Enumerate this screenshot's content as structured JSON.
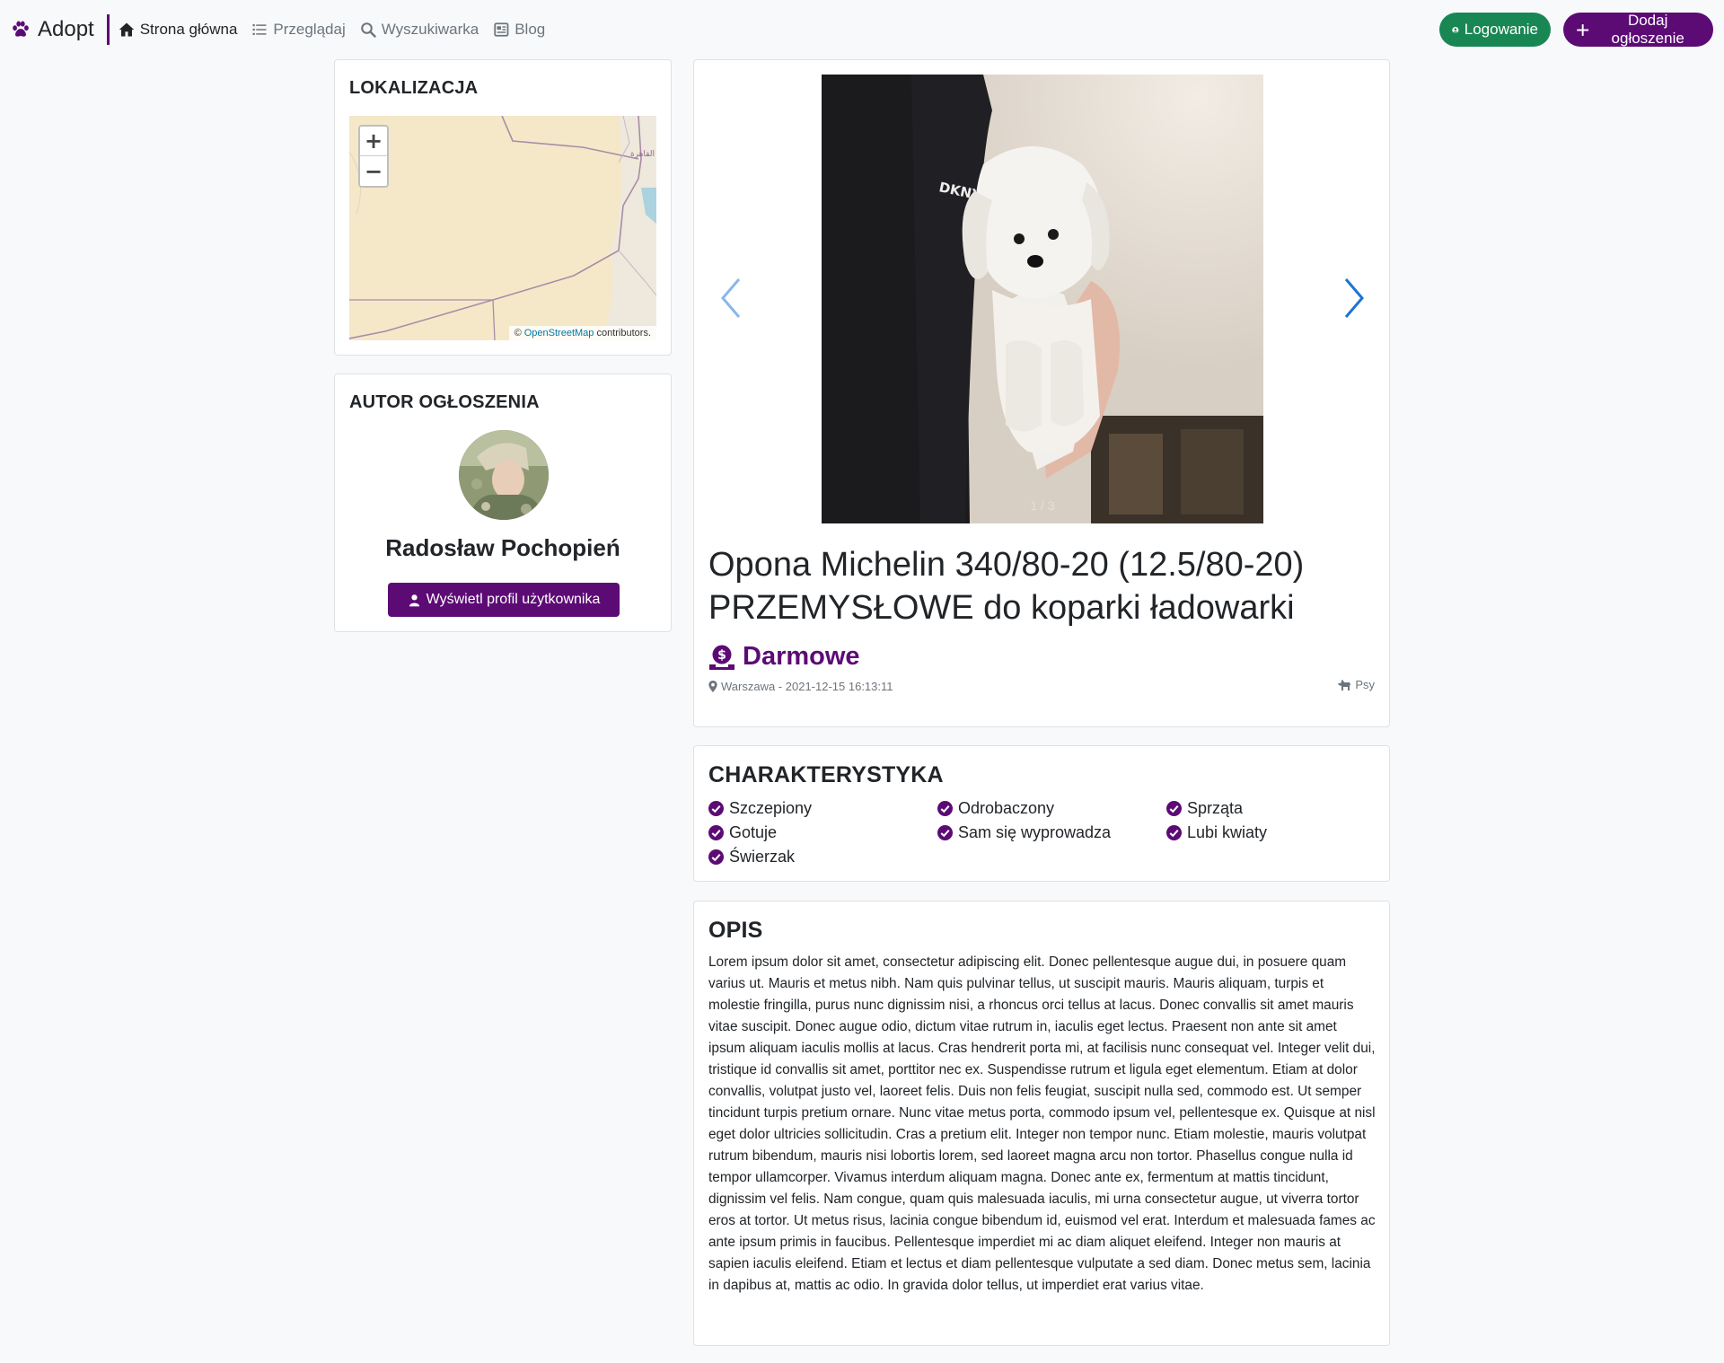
{
  "brand": {
    "name": "Adopt",
    "accent": "#5c0b75"
  },
  "nav": {
    "items": [
      {
        "label": "Strona główna",
        "icon": "home-icon",
        "active": true
      },
      {
        "label": "Przeglądaj",
        "icon": "list-icon",
        "active": false
      },
      {
        "label": "Wyszukiwarka",
        "icon": "search-icon",
        "active": false
      },
      {
        "label": "Blog",
        "icon": "newspaper-icon",
        "active": false
      }
    ],
    "login_label": "Logowanie",
    "add_label": "Dodaj ogłoszenie",
    "login_color": "#198754",
    "add_color": "#5c0b75"
  },
  "location": {
    "title": "LOKALIZACJA",
    "zoom_in": "+",
    "zoom_out": "−",
    "map_label": "القاهرة",
    "attribution_prefix": "©",
    "attribution_link": "OpenStreetMap",
    "attribution_suffix": "contributors."
  },
  "author": {
    "title": "AUTOR OGŁOSZENIA",
    "name": "Radosław Pochopień",
    "profile_button": "Wyświetl profil użytkownika"
  },
  "listing": {
    "gallery_counter": "1 / 3",
    "title": "Opona Michelin 340/80-20 (12.5/80-20) PRZEMYSŁOWE do koparki ładowarki",
    "price": "Darmowe",
    "location_date": "Warszawa - 2021-12-15 16:13:11",
    "category": "Psy"
  },
  "characteristics": {
    "title": "CHARAKTERYSTYKA",
    "items": [
      "Szczepiony",
      "Odrobaczony",
      "Sprząta",
      "Gotuje",
      "Sam się wyprowadza",
      "Lubi kwiaty",
      "Świerzak"
    ]
  },
  "description": {
    "title": "OPIS",
    "text": "Lorem ipsum dolor sit amet, consectetur adipiscing elit. Donec pellentesque augue dui, in posuere quam varius ut. Mauris et metus nibh. Nam quis pulvinar tellus, ut suscipit mauris. Mauris aliquam, turpis et molestie fringilla, purus nunc dignissim nisi, a rhoncus orci tellus at lacus. Donec convallis sit amet mauris vitae suscipit. Donec augue odio, dictum vitae rutrum in, iaculis eget lectus. Praesent non ante sit amet ipsum aliquam iaculis mollis at lacus. Cras hendrerit porta mi, at facilisis nunc consequat vel. Integer velit dui, tristique id convallis sit amet, porttitor nec ex. Suspendisse rutrum et ligula eget elementum. Etiam at dolor convallis, volutpat justo vel, laoreet felis. Duis non felis feugiat, suscipit nulla sed, commodo est. Ut semper tincidunt turpis pretium ornare. Nunc vitae metus porta, commodo ipsum vel, pellentesque ex. Quisque at nisl eget dolor ultricies sollicitudin. Cras a pretium elit. Integer non tempor nunc. Etiam molestie, mauris volutpat rutrum bibendum, mauris nisi lobortis lorem, sed laoreet magna arcu non tortor. Phasellus congue nulla id tempor ullamcorper. Vivamus interdum aliquam magna. Donec ante ex, fermentum at mattis tincidunt, dignissim vel felis. Nam congue, quam quis malesuada iaculis, mi urna consectetur augue, ut viverra tortor eros at tortor. Ut metus risus, lacinia congue bibendum id, euismod vel erat. Interdum et malesuada fames ac ante ipsum primis in faucibus. Pellentesque imperdiet mi ac diam aliquet eleifend. Integer non mauris at sapien iaculis eleifend. Etiam et lectus et diam pellentesque vulputate a sed diam. Donec metus sem, lacinia in dapibus at, mattis ac odio. In gravida dolor tellus, ut imperdiet erat varius vitae."
  }
}
